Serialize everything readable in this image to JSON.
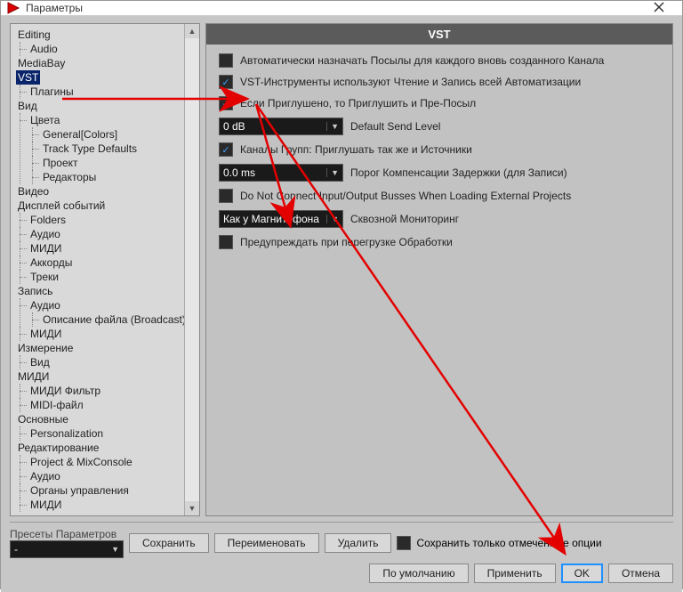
{
  "window": {
    "title": "Параметры"
  },
  "tree": {
    "items": [
      {
        "label": "Editing",
        "children": [
          {
            "label": "Audio"
          }
        ]
      },
      {
        "label": "MediaBay"
      },
      {
        "label": "VST",
        "selected": true,
        "children": [
          {
            "label": "Плагины"
          }
        ]
      },
      {
        "label": "Вид",
        "children": [
          {
            "label": "Цвета",
            "children": [
              {
                "label": "General[Colors]"
              },
              {
                "label": "Track Type Defaults"
              },
              {
                "label": "Проект"
              },
              {
                "label": "Редакторы"
              }
            ]
          }
        ]
      },
      {
        "label": "Видео"
      },
      {
        "label": "Дисплей событий",
        "children": [
          {
            "label": "Folders"
          },
          {
            "label": "Аудио"
          },
          {
            "label": "МИДИ"
          },
          {
            "label": "Аккорды"
          },
          {
            "label": "Треки"
          }
        ]
      },
      {
        "label": "Запись",
        "children": [
          {
            "label": "Аудио",
            "children": [
              {
                "label": "Описание файла (Broadcast)"
              }
            ]
          },
          {
            "label": "МИДИ"
          }
        ]
      },
      {
        "label": "Измерение",
        "children": [
          {
            "label": "Вид"
          }
        ]
      },
      {
        "label": "МИДИ",
        "children": [
          {
            "label": "МИДИ Фильтр"
          },
          {
            "label": "MIDI-файл"
          }
        ]
      },
      {
        "label": "Основные",
        "children": [
          {
            "label": "Personalization"
          }
        ]
      },
      {
        "label": "Редактирование",
        "children": [
          {
            "label": "Project & MixConsole"
          },
          {
            "label": "Аудио"
          },
          {
            "label": "Органы управления"
          },
          {
            "label": "МИДИ"
          }
        ]
      }
    ]
  },
  "panel": {
    "header": "VST",
    "rows": {
      "auto_sends": {
        "checked": false,
        "label": "Автоматически назначать Посылы для каждого вновь созданного Канала"
      },
      "vst_instruments_rw": {
        "checked": true,
        "label": "VST-Инструменты используют Чтение и Запись всей Автоматизации"
      },
      "mute_pre": {
        "checked": true,
        "label": "Если Приглушено, то Приглушить и Пре-Посыл"
      },
      "default_send_level": {
        "value": "0 dB",
        "label": "Default Send Level"
      },
      "group_channels_mute": {
        "checked": true,
        "label": "Каналы Групп: Приглушать так же и Источники"
      },
      "delay_comp": {
        "value": "0.0 ms",
        "label": "Порог Компенсации Задержки (для Записи)"
      },
      "no_connect": {
        "checked": false,
        "label": "Do Not Connect Input/Output Busses When Loading External Projects"
      },
      "monitoring": {
        "value": "Как у Магнитофона",
        "label": "Сквозной Мониторинг"
      },
      "warn_overload": {
        "checked": false,
        "label": "Предупреждать при перегрузке Обработки"
      }
    }
  },
  "presets": {
    "label": "Пресеты Параметров",
    "value": "-",
    "save": "Сохранить",
    "rename": "Переименовать",
    "delete": "Удалить",
    "save_checked": {
      "checked": false,
      "label": "Сохранить только отмеченные опции"
    }
  },
  "actions": {
    "defaults": "По умолчанию",
    "apply": "Применить",
    "ok": "OK",
    "cancel": "Отмена"
  }
}
